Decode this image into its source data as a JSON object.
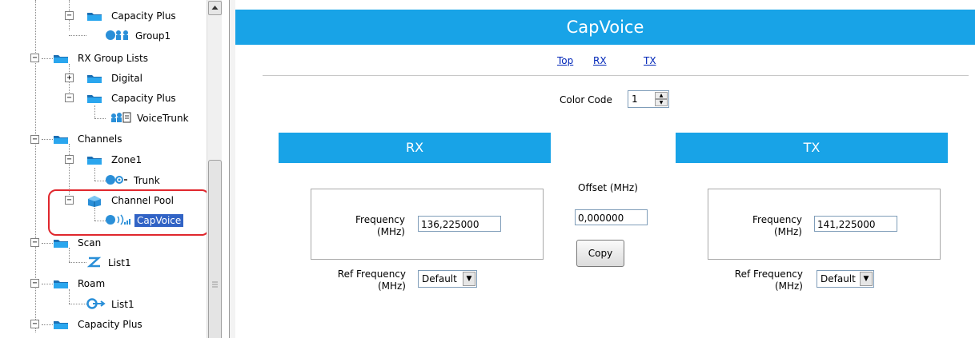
{
  "tree": {
    "items": [
      {
        "label": "Capacity Plus"
      },
      {
        "label": "Group1"
      },
      {
        "label": "RX Group Lists"
      },
      {
        "label": "Digital"
      },
      {
        "label": "Capacity Plus"
      },
      {
        "label": "VoiceTrunk"
      },
      {
        "label": "Channels"
      },
      {
        "label": "Zone1"
      },
      {
        "label": "Trunk"
      },
      {
        "label": "Channel Pool"
      },
      {
        "label": "CapVoice"
      },
      {
        "label": "Scan"
      },
      {
        "label": "List1"
      },
      {
        "label": "Roam"
      },
      {
        "label": "List1"
      },
      {
        "label": "Capacity Plus"
      }
    ]
  },
  "main": {
    "title": "CapVoice",
    "nav": {
      "top": "Top",
      "rx": "RX",
      "tx": "TX"
    },
    "color_code": {
      "label": "Color Code",
      "value": "1"
    },
    "rx": {
      "title": "RX",
      "freq_label_1": "Frequency",
      "freq_label_2": "(MHz)",
      "frequency": "136,225000",
      "ref_label_1": "Ref Frequency",
      "ref_label_2": "(MHz)",
      "ref_value": "Default"
    },
    "offset": {
      "label": "Offset (MHz)",
      "value": "0,000000",
      "copy": "Copy"
    },
    "tx": {
      "title": "TX",
      "freq_label_1": "Frequency",
      "freq_label_2": "(MHz)",
      "frequency": "141,225000",
      "ref_label_1": "Ref Frequency",
      "ref_label_2": "(MHz)",
      "ref_value": "Default"
    }
  },
  "colors": {
    "accent": "#18a3e7",
    "selection": "#3163c5",
    "highlight": "#e0272d",
    "link": "#0026b8"
  }
}
